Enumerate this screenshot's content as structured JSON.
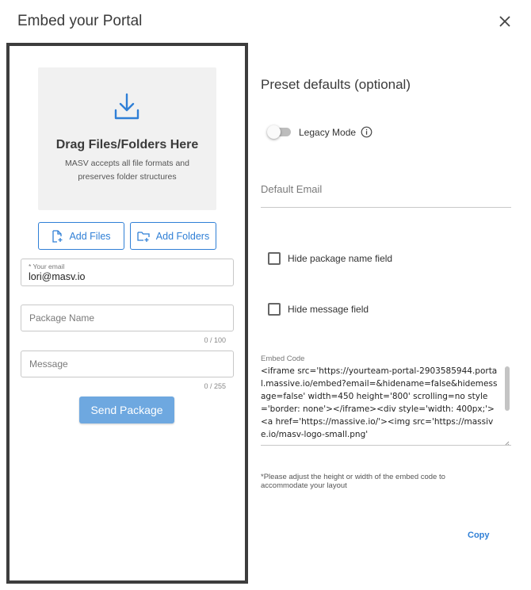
{
  "dialog": {
    "title": "Embed your Portal"
  },
  "preview": {
    "dropzone": {
      "icon": "download-icon",
      "title": "Drag Files/Folders Here",
      "subtitle": "MASV accepts all file formats and preserves folder structures"
    },
    "add_files_label": "Add Files",
    "add_folders_label": "Add Folders",
    "email": {
      "label": "* Your email",
      "value": "lori@masv.io"
    },
    "package_name": {
      "placeholder": "Package Name",
      "counter": "0 / 100"
    },
    "message": {
      "placeholder": "Message",
      "counter": "0 / 255"
    },
    "send_label": "Send Package"
  },
  "presets": {
    "title": "Preset defaults (optional)",
    "legacy_mode": {
      "label": "Legacy Mode",
      "enabled": false
    },
    "default_email_placeholder": "Default Email",
    "hide_package_name": {
      "label": "Hide package name field",
      "checked": false
    },
    "hide_message": {
      "label": "Hide message field",
      "checked": false
    },
    "embed_code_label": "Embed Code",
    "embed_code": "<iframe src='https://yourteam-portal-2903585944.portal.massive.io/embed?email=&hidename=false&hidemessage=false' width=450 height='800' scrolling=no style='border: none'></iframe><div style='width: 400px;'><a href='https://massive.io/'><img src='https://massive.io/masv-logo-small.png'",
    "note": "*Please adjust the height or width of the embed code to accommodate your layout",
    "copy_label": "Copy"
  },
  "colors": {
    "accent": "#2f7fd6",
    "send_button": "#6ea8e0",
    "frame_border": "#3d3d3d"
  }
}
